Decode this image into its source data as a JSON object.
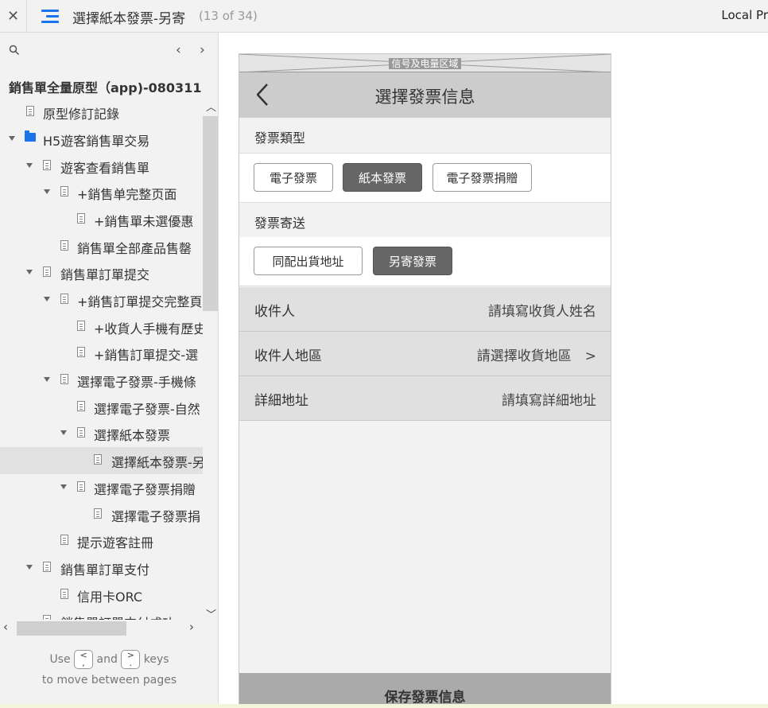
{
  "topbar": {
    "close": "✕",
    "title": "選擇紙本發票-另寄",
    "count": "(13 of 34)",
    "right_text": "Local Pr"
  },
  "sidebar": {
    "project_title": "銷售單全量原型（app)-080311",
    "items": [
      {
        "label": "原型修訂記錄"
      },
      {
        "label": "H5遊客銷售單交易"
      },
      {
        "label": "遊客查看銷售單"
      },
      {
        "label": "+銷售单完整页面"
      },
      {
        "label": "+銷售單未選優惠"
      },
      {
        "label": "銷售單全部產品售罄"
      },
      {
        "label": "銷售單訂單提交"
      },
      {
        "label": "+銷售訂單提交完整頁"
      },
      {
        "label": "+收貨人手機有歷史"
      },
      {
        "label": "+銷售訂單提交-選"
      },
      {
        "label": "選擇電子發票-手機條"
      },
      {
        "label": "選擇電子發票-自然"
      },
      {
        "label": "選擇紙本發票"
      },
      {
        "label": "選擇紙本發票-另"
      },
      {
        "label": "選擇電子發票捐贈"
      },
      {
        "label": "選擇電子發票捐"
      },
      {
        "label": "提示遊客註冊"
      },
      {
        "label": "銷售單訂單支付"
      },
      {
        "label": "信用卡ORC"
      },
      {
        "label": "銷售單訂單支付成功"
      }
    ],
    "hint_use": "Use",
    "hint_and": "and",
    "hint_keys": "keys",
    "hint_line2": "to move between pages",
    "key_prev": "<",
    "key_next": ">"
  },
  "prototype": {
    "status_bar_label": "信号及电量区域",
    "nav_title": "選擇發票信息",
    "invoice_type_heading": "發票類型",
    "invoice_types": [
      "電子發票",
      "紙本發票",
      "電子發票捐贈"
    ],
    "invoice_type_selected": "紙本發票",
    "delivery_heading": "發票寄送",
    "delivery_options": [
      "同配出貨地址",
      "另寄發票"
    ],
    "delivery_selected": "另寄發票",
    "fields": [
      {
        "label": "收件人",
        "placeholder": "請填寫收貨人姓名"
      },
      {
        "label": "收件人地區",
        "placeholder": "請選擇收貨地區　>"
      },
      {
        "label": "詳細地址",
        "placeholder": "請填寫詳細地址"
      }
    ],
    "save_button": "保存發票信息"
  },
  "colors": {
    "accent": "#1a73e8",
    "selected_pill": "#666666",
    "nav_bg": "#cccccc"
  }
}
